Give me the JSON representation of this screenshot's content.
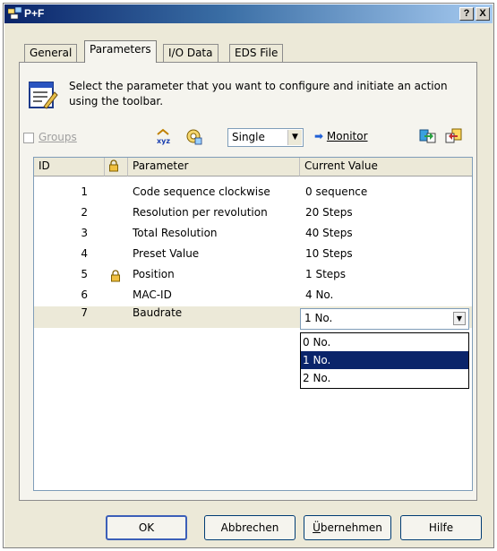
{
  "window": {
    "title": "P+F"
  },
  "titlebar_buttons": {
    "help": "?",
    "close": "X"
  },
  "tabs": [
    {
      "label": "General",
      "active": false
    },
    {
      "label": "Parameters",
      "active": true
    },
    {
      "label": "I/O Data",
      "active": false
    },
    {
      "label": "EDS File",
      "active": false
    }
  ],
  "description": "Select the parameter that you want to configure and initiate an action using the toolbar.",
  "toolbar": {
    "groups_label": "Groups",
    "groups_checked": false,
    "mode_select_value": "Single",
    "monitor_label": "Monitor",
    "icons": [
      "compare-xyz-icon",
      "parameter-settings-icon",
      "download-to-device-icon",
      "upload-from-device-icon"
    ]
  },
  "table": {
    "columns": [
      "ID",
      "",
      "Parameter",
      "Current Value"
    ],
    "rows": [
      {
        "id": "1",
        "locked": false,
        "parameter": "Code sequence clockwise",
        "value": "0 sequence"
      },
      {
        "id": "2",
        "locked": false,
        "parameter": "Resolution per revolution",
        "value": "20 Steps"
      },
      {
        "id": "3",
        "locked": false,
        "parameter": "Total Resolution",
        "value": "40 Steps"
      },
      {
        "id": "4",
        "locked": false,
        "parameter": "Preset Value",
        "value": "10 Steps"
      },
      {
        "id": "5",
        "locked": true,
        "parameter": "Position",
        "value": "1 Steps"
      },
      {
        "id": "6",
        "locked": false,
        "parameter": "MAC-ID",
        "value": "4 No."
      },
      {
        "id": "7",
        "locked": false,
        "parameter": "Baudrate",
        "value": "1 No."
      }
    ]
  },
  "dropdown": {
    "selected": "1 No.",
    "options": [
      "0 No.",
      "1 No.",
      "2 No."
    ],
    "highlighted_index": 1
  },
  "buttons": {
    "ok": "OK",
    "cancel": "Abbrechen",
    "apply_prefix": "Ü",
    "apply_rest": "bernehmen",
    "help": "Hilfe"
  }
}
